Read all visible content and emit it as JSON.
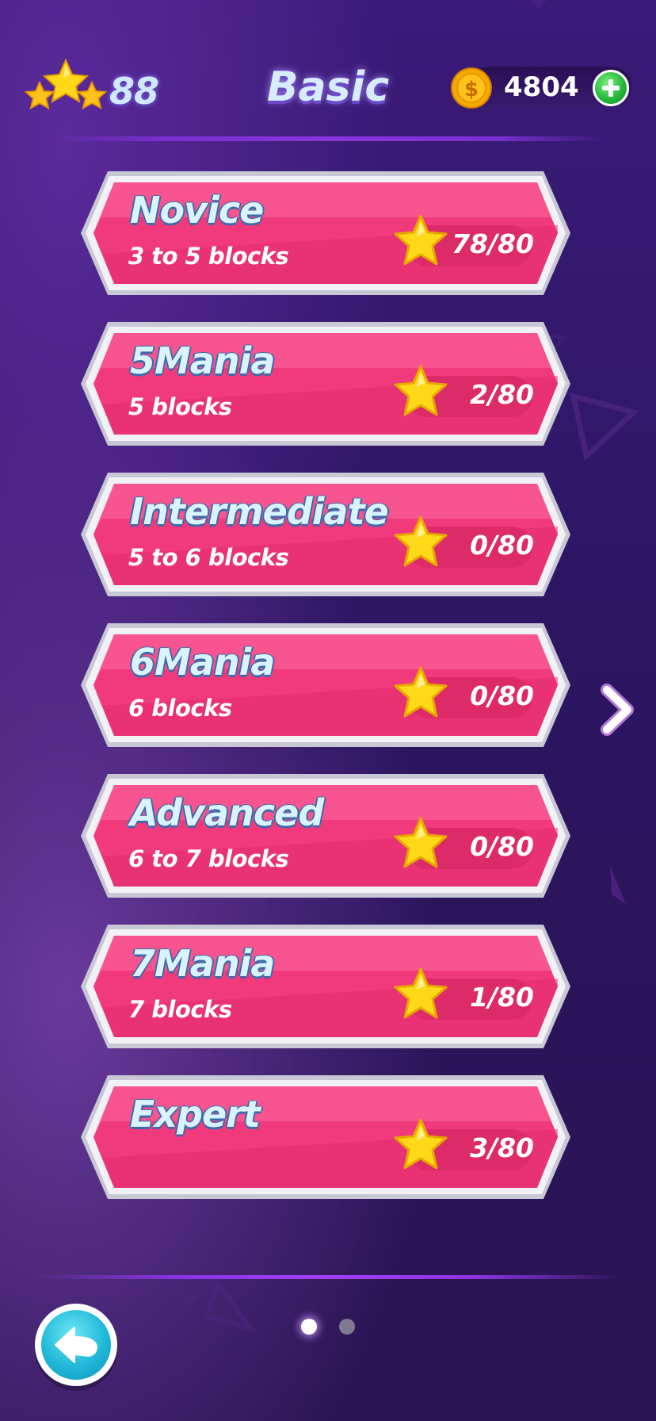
{
  "header": {
    "star_total": "88",
    "pack_title": "Basic",
    "coins": "4804"
  },
  "levels": [
    {
      "name": "Novice",
      "subtitle": "3 to 5 blocks",
      "progress": "78/80"
    },
    {
      "name": "5Mania",
      "subtitle": "5 blocks",
      "progress": "2/80"
    },
    {
      "name": "Intermediate",
      "subtitle": "5 to 6 blocks",
      "progress": "0/80"
    },
    {
      "name": "6Mania",
      "subtitle": "6 blocks",
      "progress": "0/80"
    },
    {
      "name": "Advanced",
      "subtitle": "6 to 7 blocks",
      "progress": "0/80"
    },
    {
      "name": "7Mania",
      "subtitle": "7 blocks",
      "progress": "1/80"
    },
    {
      "name": "Expert",
      "subtitle": "",
      "progress": "3/80"
    }
  ],
  "pagination": {
    "total_pages": 2,
    "current_page": 1
  },
  "icons": {
    "star_total": "stars-icon",
    "coin": "coin-icon",
    "add": "plus-icon",
    "next": "chevron-right-icon",
    "back": "back-arrow-icon",
    "progress": "star-icon"
  },
  "colors": {
    "background": "#2c1560",
    "card_pink": "#f03a7c",
    "card_border": "#e7e7ef",
    "star_yellow": "#ffd81a",
    "accent_cyan": "#20b8d8"
  }
}
